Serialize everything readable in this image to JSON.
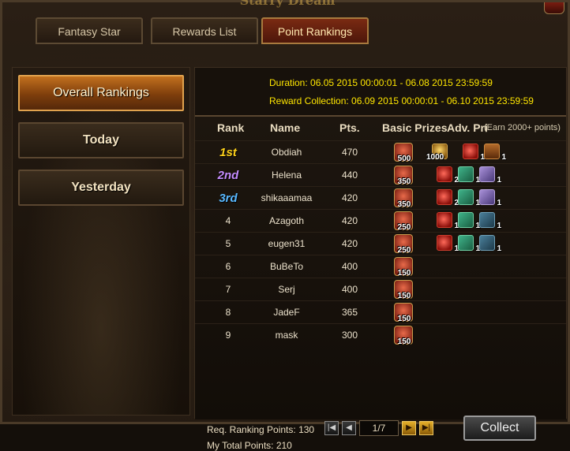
{
  "window": {
    "title": "Starry Dream"
  },
  "tabs": [
    {
      "label": "Fantasy Star"
    },
    {
      "label": "Rewards List"
    },
    {
      "label": "Point Rankings"
    }
  ],
  "sidebar": {
    "items": [
      {
        "label": "Overall Rankings"
      },
      {
        "label": "Today"
      },
      {
        "label": "Yesterday"
      }
    ]
  },
  "period": {
    "duration": "Duration: 06.05 2015 00:00:01 - 06.08 2015 23:59:59",
    "collection": "Reward Collection: 06.09 2015 00:00:01 - 06.10 2015 23:59:59"
  },
  "table": {
    "headers": {
      "rank": "Rank",
      "name": "Name",
      "pts": "Pts.",
      "basic": "Basic Prizes",
      "adv": "Adv. Pri",
      "note": "(Earn 2000+ points)"
    },
    "rows": [
      {
        "rank": "1st",
        "name": "Obdiah",
        "pts": "470",
        "basic": "500",
        "adv": [
          "1000",
          "1",
          "1"
        ]
      },
      {
        "rank": "2nd",
        "name": "Helena",
        "pts": "440",
        "basic": "350",
        "adv": [
          "2",
          "1",
          "1"
        ]
      },
      {
        "rank": "3rd",
        "name": "shikaaamaa",
        "pts": "420",
        "basic": "350",
        "adv": [
          "2",
          "1",
          "1"
        ]
      },
      {
        "rank": "4",
        "name": "Azagoth",
        "pts": "420",
        "basic": "250",
        "adv": [
          "1",
          "1",
          "1"
        ]
      },
      {
        "rank": "5",
        "name": "eugen31",
        "pts": "420",
        "basic": "250",
        "adv": [
          "1",
          "1",
          "1"
        ]
      },
      {
        "rank": "6",
        "name": "BuBeTo",
        "pts": "400",
        "basic": "150",
        "adv": []
      },
      {
        "rank": "7",
        "name": "Serj",
        "pts": "400",
        "basic": "150",
        "adv": []
      },
      {
        "rank": "8",
        "name": "JadeF",
        "pts": "365",
        "basic": "150",
        "adv": []
      },
      {
        "rank": "9",
        "name": "mask",
        "pts": "300",
        "basic": "150",
        "adv": []
      }
    ]
  },
  "footer": {
    "req_points": "Req. Ranking Points: 130",
    "total_points": "My Total Points: 210",
    "page": "1/7",
    "collect_label": "Collect"
  },
  "colors": {
    "duration_text": "#ffe600",
    "rank1": "#ffd21a",
    "rank2": "#c58cff",
    "rank3": "#58b8ff",
    "active_tab": "#7a2a12",
    "active_side": "#c2701e"
  }
}
